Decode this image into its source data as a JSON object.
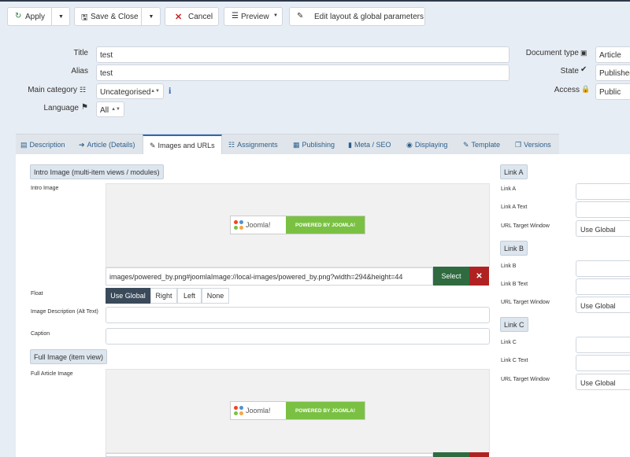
{
  "toolbar": {
    "apply": "Apply",
    "save_close": "Save & Close",
    "cancel": "Cancel",
    "preview": "Preview",
    "edit_layout": "Edit layout & global parameters"
  },
  "form": {
    "title_label": "Title",
    "title_value": "test",
    "alias_label": "Alias",
    "alias_value": "test",
    "category_label": "Main category",
    "category_value": "Uncategorised",
    "language_label": "Language",
    "language_value": "All",
    "doctype_label": "Document type",
    "doctype_value": "Article",
    "state_label": "State",
    "state_value": "Published",
    "access_label": "Access",
    "access_value": "Public"
  },
  "tabs": [
    "Description",
    "Article (Details)",
    "Images and URLs",
    "Assignments",
    "Publishing",
    "Meta / SEO",
    "Displaying",
    "Template",
    "Versions"
  ],
  "intro": {
    "section": "Intro Image (multi-item views / modules)",
    "image_label": "Intro Image",
    "path": "images/powered_by.png#joomlaImage://local-images/powered_by.png?width=294&height=44",
    "select": "Select",
    "float_label": "Float",
    "float_options": [
      "Use Global",
      "Right",
      "Left",
      "None"
    ],
    "alt_label": "Image Description (Alt Text)",
    "caption_label": "Caption"
  },
  "full": {
    "section": "Full Image (item view)",
    "image_label": "Full Article Image"
  },
  "powered": {
    "joomla": "Joomla!",
    "text": "POWERED BY JOOMLA!"
  },
  "links": {
    "a_section": "Link A",
    "a_label": "Link A",
    "a_text": "Link A Text",
    "b_section": "Link B",
    "b_label": "Link B",
    "b_text": "Link B Text",
    "c_section": "Link C",
    "c_label": "Link C",
    "c_text": "Link C Text",
    "target_label": "URL Target Window",
    "target_value": "Use Global"
  },
  "colors": {
    "select_green": "#2f6b3f",
    "danger_red": "#b02222",
    "joomla_green": "#7ac143",
    "tab_accent": "#2a69b8"
  }
}
